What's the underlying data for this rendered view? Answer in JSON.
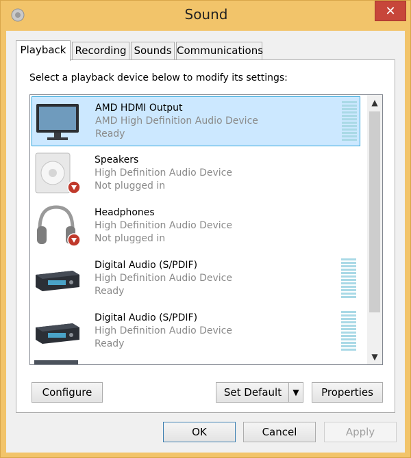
{
  "window": {
    "title": "Sound",
    "close_glyph": "✕"
  },
  "tabs": [
    {
      "label": "Playback",
      "active": true
    },
    {
      "label": "Recording",
      "active": false
    },
    {
      "label": "Sounds",
      "active": false
    },
    {
      "label": "Communications",
      "active": false
    }
  ],
  "playback": {
    "instruction": "Select a playback device below to modify its settings:",
    "devices": [
      {
        "name": "AMD HDMI Output",
        "description": "AMD High Definition Audio Device",
        "status": "Ready",
        "icon": "monitor-icon",
        "selected": true,
        "has_meter": true
      },
      {
        "name": "Speakers",
        "description": "High Definition Audio Device",
        "status": "Not plugged in",
        "icon": "speaker-icon",
        "badge": "down-arrow-badge-icon",
        "has_meter": false
      },
      {
        "name": "Headphones",
        "description": "High Definition Audio Device",
        "status": "Not plugged in",
        "icon": "headphones-icon",
        "badge": "down-arrow-badge-icon",
        "has_meter": false
      },
      {
        "name": "Digital Audio (S/PDIF)",
        "description": "High Definition Audio Device",
        "status": "Ready",
        "icon": "receiver-icon",
        "has_meter": true
      },
      {
        "name": "Digital Audio (S/PDIF)",
        "description": "High Definition Audio Device",
        "status": "Ready",
        "icon": "receiver-icon",
        "has_meter": true
      }
    ],
    "scroll_up_glyph": "▲",
    "scroll_down_glyph": "▼"
  },
  "buttons": {
    "configure": "Configure",
    "set_default": "Set Default",
    "set_default_arrow": "▼",
    "properties": "Properties",
    "ok": "OK",
    "cancel": "Cancel",
    "apply": "Apply"
  },
  "colors": {
    "title_bar": "#f2c46a",
    "close_button": "#c7463a",
    "selection_fill": "#cce8ff",
    "selection_border": "#26a0da",
    "meter_teal": "#a9d9e6"
  }
}
